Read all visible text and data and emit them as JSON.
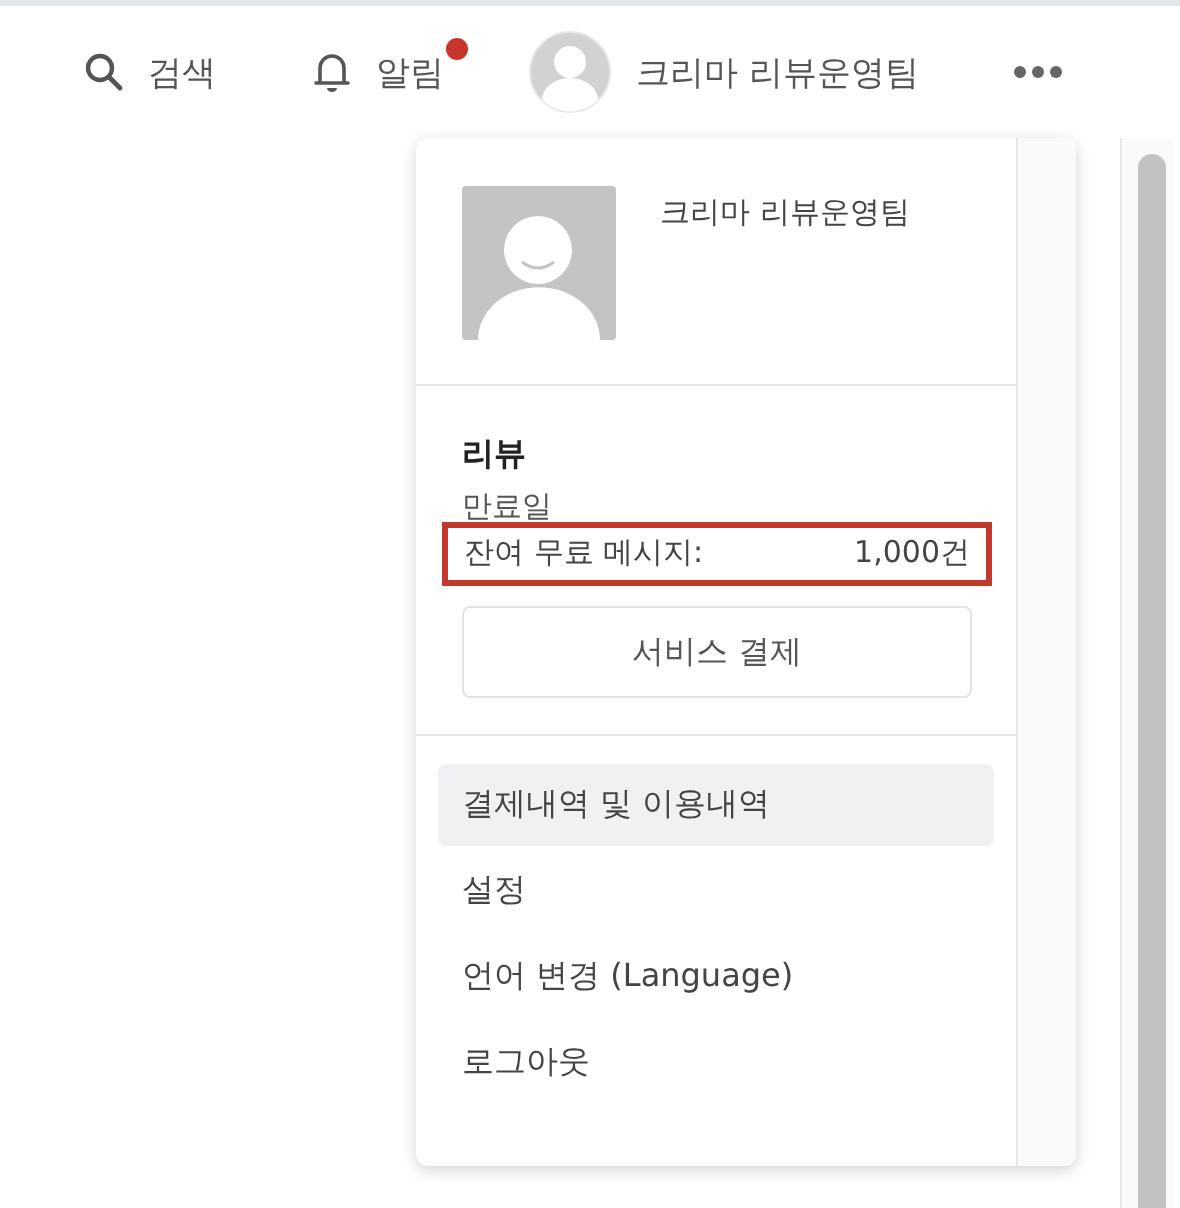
{
  "topbar": {
    "search": "검색",
    "notifications": {
      "label": "알림",
      "has_new": true
    },
    "user": "크리마 리뷰운영팀"
  },
  "dropdown": {
    "user_name": "크리마 리뷰운영팀",
    "service": {
      "title": "리뷰",
      "expiry_label": "만료일",
      "remaining_label": "잔여 무료 메시지:",
      "remaining_value": "1,000건",
      "highlighted": true
    },
    "payment_button": "서비스 결제",
    "menu": [
      {
        "label": "결제내역 및 이용내역",
        "selected": true
      },
      {
        "label": "설정",
        "selected": false
      },
      {
        "label": "언어 변경 (Language)",
        "selected": false
      },
      {
        "label": "로그아웃",
        "selected": false
      }
    ]
  }
}
